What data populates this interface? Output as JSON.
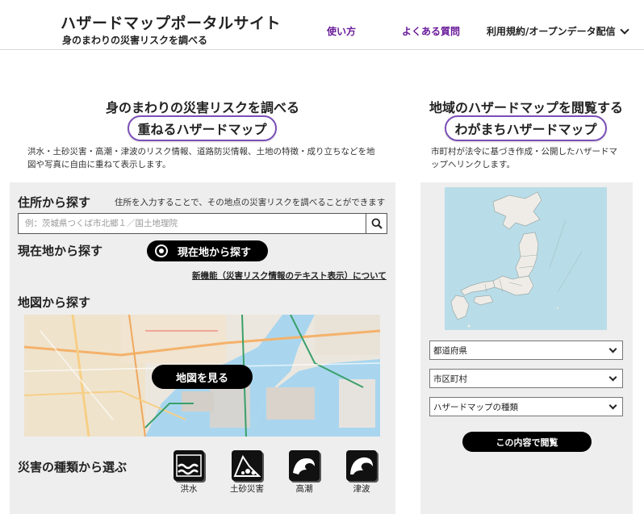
{
  "header": {
    "site_title": "ハザードマップポータルサイト",
    "site_subtitle": "身のまわりの災害リスクを調べる",
    "nav": {
      "howto": "使い方",
      "faq": "よくある質問",
      "terms": "利用規約/オープンデータ配信"
    }
  },
  "left": {
    "heading": "身のまわりの災害リスクを調べる",
    "pill": "重ねるハザードマップ",
    "description_line1": "洪水・土砂災害・高潮・津波のリスク情報、道路防災情報、土地の特徴・成り立ちなどを地",
    "description_line2": "図や写真に自由に重ねて表示します。",
    "address": {
      "label": "住所から探す",
      "hint": "住所を入力することで、その地点の災害リスクを調べることができます",
      "placeholder": "例：茨城県つくば市北郷１／国土地理院"
    },
    "location": {
      "label": "現在地から探す",
      "button": "現在地から探す",
      "new_feature_link": "新機能（災害リスク情報のテキスト表示）について"
    },
    "map": {
      "label": "地図から探す",
      "button": "地図を見る"
    },
    "hazards": {
      "label": "災害の種類から選ぶ",
      "items": [
        {
          "label": "洪水",
          "icon": "flood-icon"
        },
        {
          "label": "土砂災害",
          "icon": "landslide-icon"
        },
        {
          "label": "高潮",
          "icon": "storm-surge-icon"
        },
        {
          "label": "津波",
          "icon": "tsunami-icon"
        }
      ]
    }
  },
  "right": {
    "heading": "地域のハザードマップを閲覧する",
    "pill": "わがまちハザードマップ",
    "description_line1": "市町村が法令に基づき作成・公開したハザードマ",
    "description_line2": "ップへリンクします。",
    "selects": {
      "prefecture": "都道府県",
      "city": "市区町村",
      "map_type": "ハザードマップの種類"
    },
    "view_button": "この内容で閲覧"
  },
  "colors": {
    "accent": "#7b4fb8",
    "nav_link": "#6a1b9a",
    "panel_bg": "#eeeeee",
    "sea": "#b9dde8",
    "button_bg": "#000000"
  }
}
